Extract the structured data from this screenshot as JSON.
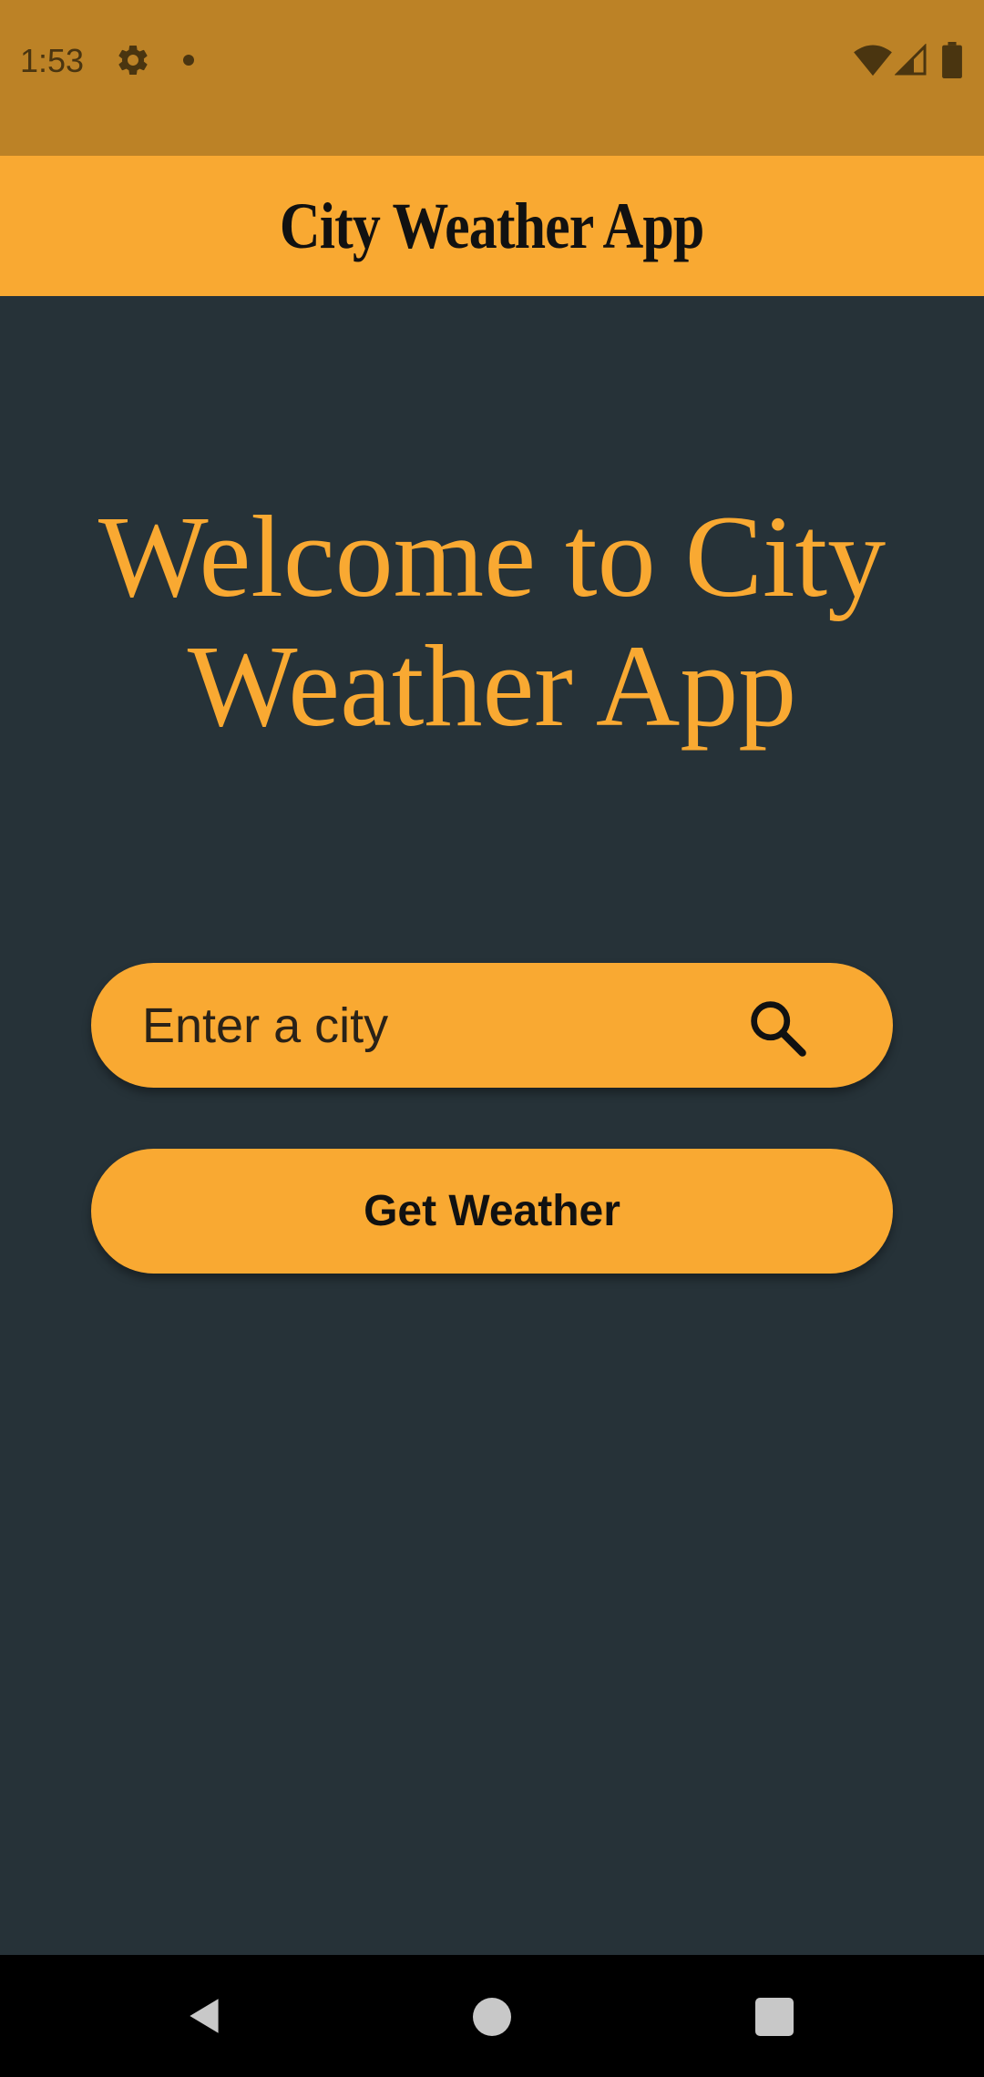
{
  "status_bar": {
    "time": "1:53",
    "icons": [
      "gear-icon",
      "notification-dot-icon",
      "wifi-icon",
      "signal-icon",
      "battery-icon"
    ]
  },
  "app_bar": {
    "title": "City Weather App"
  },
  "main": {
    "welcome_line1": "Welcome to City",
    "welcome_line2": "Weather App",
    "search": {
      "placeholder": "Enter a city",
      "value": "",
      "icon": "search-icon"
    },
    "button_label": "Get Weather"
  },
  "nav_bar": {
    "icons": [
      "back-icon",
      "home-icon",
      "recents-icon"
    ]
  },
  "colors": {
    "status_bar": "#BC8226",
    "accent": "#F9A932",
    "background": "#263238",
    "nav_bar": "#000000"
  }
}
